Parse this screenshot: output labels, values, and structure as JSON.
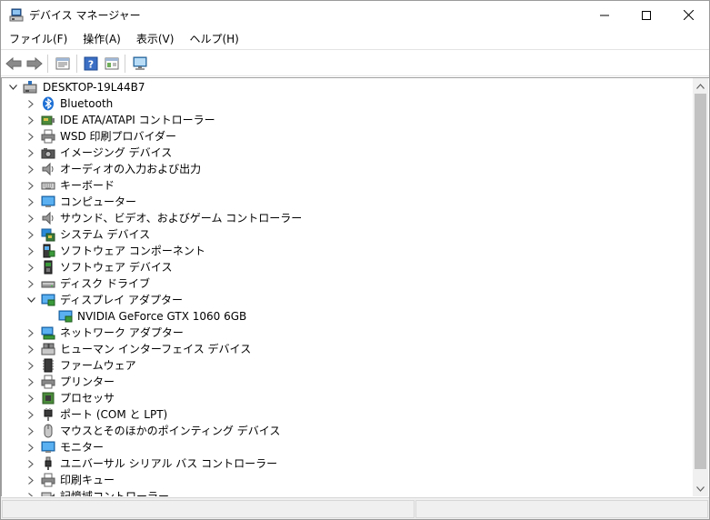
{
  "window": {
    "title": "デバイス マネージャー",
    "icon": "device-manager-icon"
  },
  "menu": [
    {
      "label": "ファイル(F)"
    },
    {
      "label": "操作(A)"
    },
    {
      "label": "表示(V)"
    },
    {
      "label": "ヘルプ(H)"
    }
  ],
  "toolbar": {
    "buttons": [
      "back-arrow-icon",
      "forward-arrow-icon",
      "properties-icon",
      "help-icon",
      "view-icon",
      "scan-hardware-icon"
    ]
  },
  "tree": {
    "root": {
      "label": "DESKTOP-19L44B7",
      "icon": "computer-icon",
      "expanded": true
    },
    "categories": [
      {
        "label": "Bluetooth",
        "icon": "bluetooth-icon",
        "expanded": false
      },
      {
        "label": "IDE ATA/ATAPI コントローラー",
        "icon": "ide-controller-icon",
        "expanded": false
      },
      {
        "label": "WSD 印刷プロバイダー",
        "icon": "printer-icon",
        "expanded": false
      },
      {
        "label": "イメージング デバイス",
        "icon": "camera-icon",
        "expanded": false
      },
      {
        "label": "オーディオの入力および出力",
        "icon": "speaker-icon",
        "expanded": false
      },
      {
        "label": "キーボード",
        "icon": "keyboard-icon",
        "expanded": false
      },
      {
        "label": "コンピューター",
        "icon": "monitor-icon",
        "expanded": false
      },
      {
        "label": "サウンド、ビデオ、およびゲーム コントローラー",
        "icon": "speaker-icon",
        "expanded": false
      },
      {
        "label": "システム デバイス",
        "icon": "system-device-icon",
        "expanded": false
      },
      {
        "label": "ソフトウェア コンポーネント",
        "icon": "software-component-icon",
        "expanded": false
      },
      {
        "label": "ソフトウェア デバイス",
        "icon": "software-device-icon",
        "expanded": false
      },
      {
        "label": "ディスク ドライブ",
        "icon": "disk-drive-icon",
        "expanded": false
      },
      {
        "label": "ディスプレイ アダプター",
        "icon": "display-adapter-icon",
        "expanded": true,
        "children": [
          {
            "label": "NVIDIA GeForce GTX 1060 6GB",
            "icon": "display-adapter-icon"
          }
        ]
      },
      {
        "label": "ネットワーク アダプター",
        "icon": "network-adapter-icon",
        "expanded": false
      },
      {
        "label": "ヒューマン インターフェイス デバイス",
        "icon": "hid-icon",
        "expanded": false
      },
      {
        "label": "ファームウェア",
        "icon": "firmware-icon",
        "expanded": false
      },
      {
        "label": "プリンター",
        "icon": "printer-icon",
        "expanded": false
      },
      {
        "label": "プロセッサ",
        "icon": "processor-icon",
        "expanded": false
      },
      {
        "label": "ポート (COM と LPT)",
        "icon": "port-icon",
        "expanded": false
      },
      {
        "label": "マウスとそのほかのポインティング デバイス",
        "icon": "mouse-icon",
        "expanded": false
      },
      {
        "label": "モニター",
        "icon": "monitor-icon",
        "expanded": false
      },
      {
        "label": "ユニバーサル シリアル バス コントローラー",
        "icon": "usb-icon",
        "expanded": false
      },
      {
        "label": "印刷キュー",
        "icon": "printer-icon",
        "expanded": false
      },
      {
        "label": "記憶域コントローラー",
        "icon": "storage-controller-icon",
        "expanded": false
      }
    ]
  },
  "colors": {
    "accent": "#0078d7",
    "scrollbar_thumb": "#c2c2c2",
    "statusbar_bg": "#f0f0f0"
  }
}
